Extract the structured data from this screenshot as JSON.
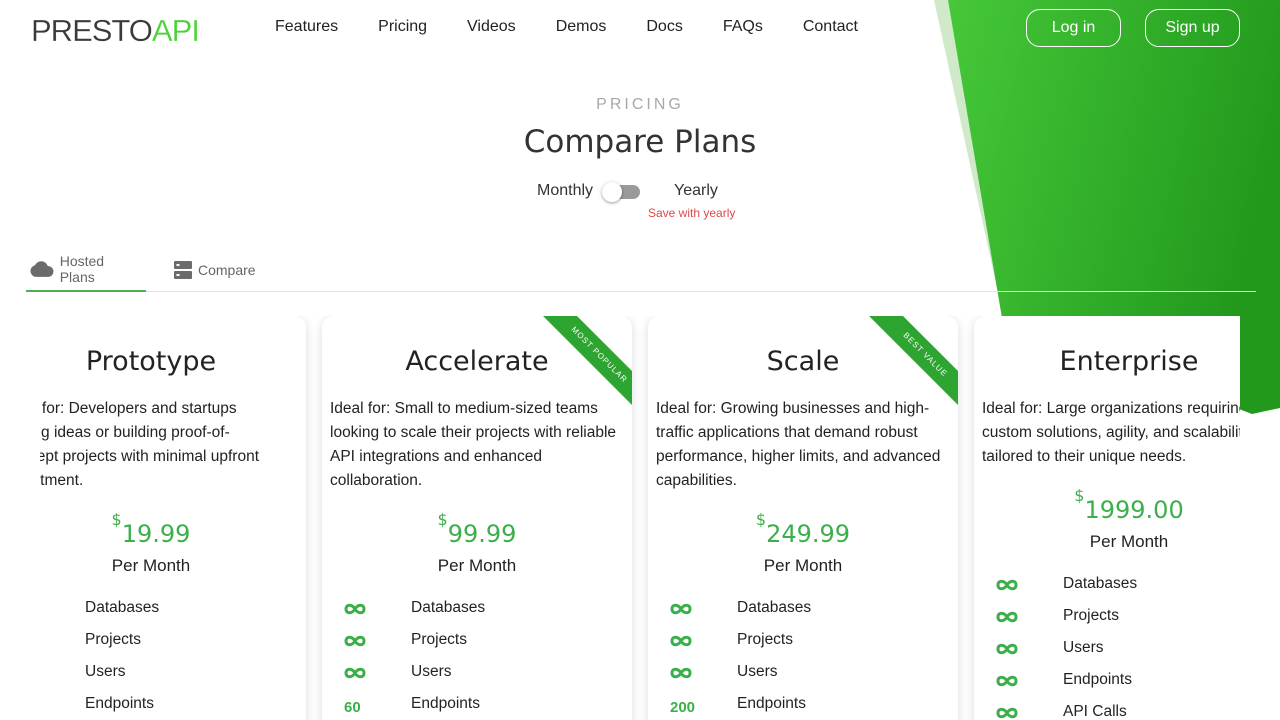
{
  "brand": {
    "name_a": "PRESTO",
    "name_b": "API"
  },
  "nav": {
    "items": [
      "Features",
      "Pricing",
      "Videos",
      "Demos",
      "Docs",
      "FAQs",
      "Contact"
    ],
    "login": "Log in",
    "signup": "Sign up"
  },
  "hero": {
    "eyebrow": "PRICING",
    "title": "Compare Plans",
    "monthly": "Monthly",
    "yearly": "Yearly",
    "save_note": "Save with yearly"
  },
  "tabs": {
    "hosted": "Hosted Plans",
    "compare": "Compare"
  },
  "colors": {
    "accent": "#3bb04a",
    "brand_green": "#2ea12a",
    "save_note": "#e04848"
  },
  "plans": [
    {
      "name": "Prototype",
      "desc_lines": [
        "Ideal for: Developers and startups",
        "testing ideas or building proof-of-",
        "concept projects with minimal upfront",
        "investment."
      ],
      "currency": "$",
      "price": "19.99",
      "period": "Per Month",
      "features": [
        {
          "value": "",
          "name": "Databases"
        },
        {
          "value": "",
          "name": "Projects"
        },
        {
          "value": "",
          "name": "Users"
        },
        {
          "value": "",
          "name": "Endpoints"
        }
      ]
    },
    {
      "name": "Accelerate",
      "desc": "Ideal for: Small to medium-sized teams looking to scale their projects with reliable API integrations and enhanced collaboration.",
      "currency": "$",
      "price": "99.99",
      "period": "Per Month",
      "ribbon": "MOST POPULAR",
      "features": [
        {
          "value": "∞",
          "name": "Databases"
        },
        {
          "value": "∞",
          "name": "Projects"
        },
        {
          "value": "∞",
          "name": "Users"
        },
        {
          "value": "60",
          "name": "Endpoints"
        }
      ]
    },
    {
      "name": "Scale",
      "desc": "Ideal for: Growing businesses and high-traffic applications that demand robust performance, higher limits, and advanced capabilities.",
      "currency": "$",
      "price": "249.99",
      "period": "Per Month",
      "ribbon": "BEST VALUE",
      "features": [
        {
          "value": "∞",
          "name": "Databases"
        },
        {
          "value": "∞",
          "name": "Projects"
        },
        {
          "value": "∞",
          "name": "Users"
        },
        {
          "value": "200",
          "name": "Endpoints"
        }
      ]
    },
    {
      "name": "Enterprise",
      "desc": "Ideal for: Large organizations requiring custom solutions, agility, and scalability tailored to their unique needs.",
      "currency": "$",
      "price": "1999.00",
      "period": "Per Month",
      "features": [
        {
          "value": "∞",
          "name": "Databases"
        },
        {
          "value": "∞",
          "name": "Projects"
        },
        {
          "value": "∞",
          "name": "Users"
        },
        {
          "value": "∞",
          "name": "Endpoints"
        },
        {
          "value": "∞",
          "name": "API Calls"
        }
      ]
    }
  ]
}
